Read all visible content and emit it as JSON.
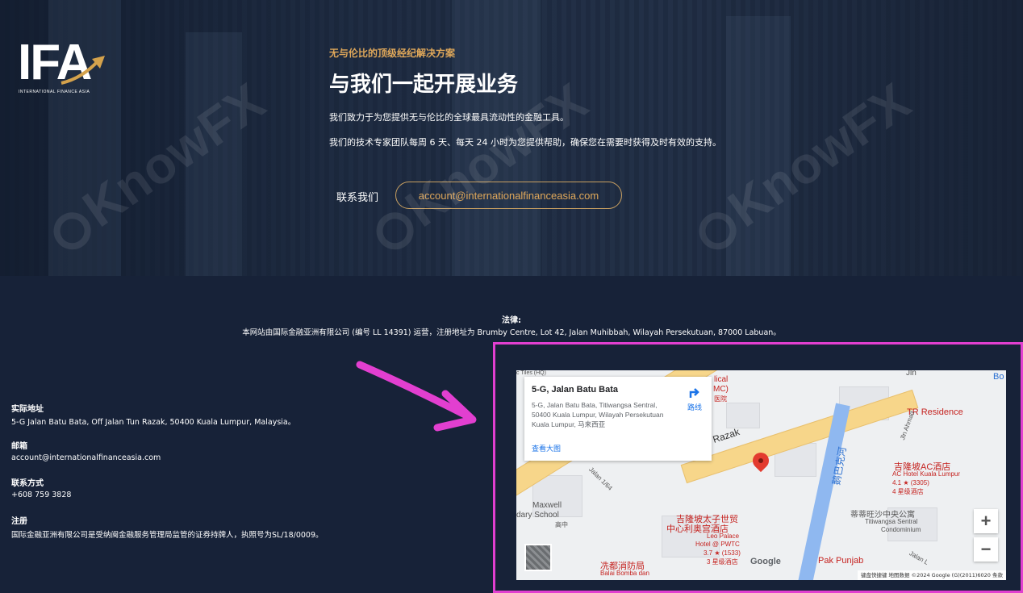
{
  "logo": {
    "text": "IFA",
    "subtitle": "INTERNATIONAL FINANCE ASIA"
  },
  "hero": {
    "eyebrow": "无与伦比的顶级经纪解决方案",
    "headline": "与我们一起开展业务",
    "para1": "我们致力于为您提供无与伦比的全球最具流动性的金融工具。",
    "para2": "我们的技术专家团队每周 6 天、每天 24 小时为您提供帮助，确保您在需要时获得及时有效的支持。",
    "contact_label": "联系我们",
    "contact_email": "account@internationalfinanceasia.com"
  },
  "legal": {
    "title": "法律:",
    "text": "本网站由国际金融亚洲有限公司 (编号 LL 14391) 运营，注册地址为 Brumby Centre, Lot 42, Jalan Muhibbah, Wilayah Persekutuan, 87000 Labuan。"
  },
  "info": {
    "address_title": "实际地址",
    "address": "5-G Jalan Batu Bata, Off Jalan Tun Razak, 50400 Kuala Lumpur, Malaysia。",
    "email_title": "邮箱",
    "email": "account@internationalfinanceasia.com",
    "phone_title": "联系方式",
    "phone": "+608 759 3828",
    "reg_title": "注册",
    "reg_text": "国际金融亚洲有限公司是受纳闽金融服务管理局监管的证券持牌人，执照号为SL/18/0009。"
  },
  "watermark": "KnowFX",
  "map": {
    "place_title": "5-G, Jalan Batu Bata",
    "place_address": "5-G, Jalan Batu Bata, Titiwangsa Sentral, 50400 Kuala Lumpur, Wilayah Persekutuan Kuala Lumpur, 马来西亚",
    "view_larger": "查看大图",
    "directions": "路线",
    "labels": {
      "tiles": "c Tiles (HQ)",
      "medical": "lical",
      "mc": "MC)",
      "hospital": "医院",
      "razak": "Razak",
      "tr_residence": "TR Residence",
      "jln_ahmad": "Jln Ahmad",
      "jalan164": "Jalan 1/64",
      "maxwell": "Maxwell",
      "dary_school": "dary School",
      "gaozhong": "高中",
      "river": "鹅巴克河",
      "ac_hotel_cn": "吉隆坡AC酒店",
      "ac_hotel_en": "AC Hotel Kuala Lumpur",
      "ac_rating": "4.1 ★ (3305)",
      "ac_stars": "4 星级酒店",
      "titiwangsa_cn": "蒂蒂旺沙中央公寓",
      "titiwangsa_en": "Titiwangsa Sentral",
      "condominium": "Condominium",
      "prince_cn1": "吉隆坡太子世贸",
      "prince_cn2": "中心利奥宫酒店",
      "leo_palace": "Leo Palace",
      "hotel_pwtc": "Hotel @ PWTC",
      "prince_rating": "3.7 ★ (1533)",
      "prince_stars": "3 星级酒店",
      "fire_cn": "冼都消防局",
      "fire_en1": "Balai Bomba dan",
      "pak_punjab": "Pak Punjab",
      "jalan_l": "Jalan L",
      "jln": "Jln",
      "bo": "Bo"
    },
    "zoom_in": "+",
    "zoom_out": "−",
    "google": "Google",
    "attribution": "键盘快捷键   地图数据 ©2024 Google (G)(2011)6020   条款"
  }
}
